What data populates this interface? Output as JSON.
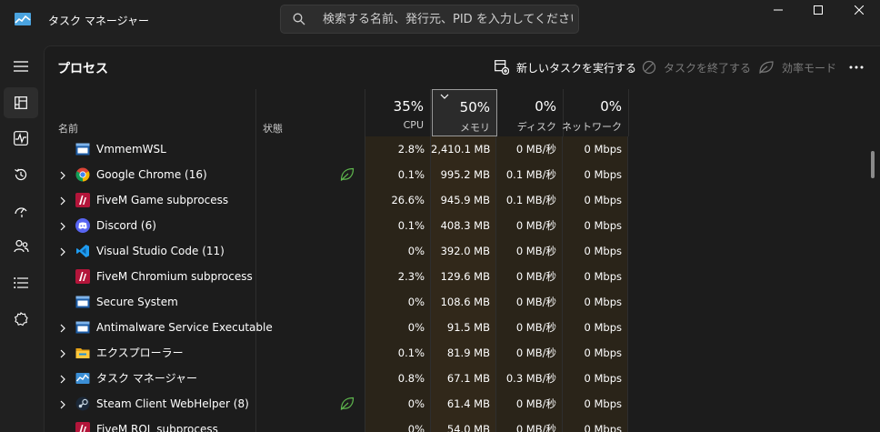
{
  "window": {
    "title": "タスク マネージャー",
    "search_placeholder": "検索する名前、発行元、PID を入力してください"
  },
  "toolbar": {
    "page_title": "プロセス",
    "new_task": "新しいタスクを実行する",
    "end_task": "タスクを終了する",
    "efficiency_mode": "効率モード"
  },
  "nav": {
    "items": [
      "menu-icon",
      "processes-icon",
      "performance-icon",
      "app-history-icon",
      "startup-apps-icon",
      "users-icon",
      "details-icon",
      "services-icon"
    ]
  },
  "columns": {
    "name": "名前",
    "status": "状態",
    "cpu_pct": "35%",
    "cpu_label": "CPU",
    "mem_pct": "50%",
    "mem_label": "メモリ",
    "disk_pct": "0%",
    "disk_label": "ディスク",
    "net_pct": "0%",
    "net_label": "ネットワーク"
  },
  "processes": [
    {
      "name": "VmmemWSL",
      "icon": "system-window-icon",
      "expandable": false,
      "eco": false,
      "cpu": "2.8%",
      "mem": "2,410.1 MB",
      "disk": "0 MB/秒",
      "net": "0 Mbps"
    },
    {
      "name": "Google Chrome (16)",
      "icon": "chrome-icon",
      "expandable": true,
      "eco": true,
      "cpu": "0.1%",
      "mem": "995.2 MB",
      "disk": "0.1 MB/秒",
      "net": "0 Mbps"
    },
    {
      "name": "FiveM Game subprocess",
      "icon": "fivem-icon",
      "expandable": true,
      "eco": false,
      "cpu": "26.6%",
      "mem": "945.9 MB",
      "disk": "0.1 MB/秒",
      "net": "0 Mbps"
    },
    {
      "name": "Discord (6)",
      "icon": "discord-icon",
      "expandable": true,
      "eco": false,
      "cpu": "0.1%",
      "mem": "408.3 MB",
      "disk": "0 MB/秒",
      "net": "0 Mbps"
    },
    {
      "name": "Visual Studio Code (11)",
      "icon": "vscode-icon",
      "expandable": true,
      "eco": false,
      "cpu": "0%",
      "mem": "392.0 MB",
      "disk": "0 MB/秒",
      "net": "0 Mbps"
    },
    {
      "name": "FiveM Chromium subprocess",
      "icon": "fivem-icon",
      "expandable": false,
      "eco": false,
      "cpu": "2.3%",
      "mem": "129.6 MB",
      "disk": "0 MB/秒",
      "net": "0 Mbps"
    },
    {
      "name": "Secure System",
      "icon": "system-window-icon",
      "expandable": false,
      "eco": false,
      "cpu": "0%",
      "mem": "108.6 MB",
      "disk": "0 MB/秒",
      "net": "0 Mbps"
    },
    {
      "name": "Antimalware Service Executable",
      "icon": "system-window-icon",
      "expandable": true,
      "eco": false,
      "cpu": "0%",
      "mem": "91.5 MB",
      "disk": "0 MB/秒",
      "net": "0 Mbps"
    },
    {
      "name": "エクスプローラー",
      "icon": "folder-icon",
      "expandable": true,
      "eco": false,
      "cpu": "0.1%",
      "mem": "81.9 MB",
      "disk": "0 MB/秒",
      "net": "0 Mbps"
    },
    {
      "name": "タスク マネージャー",
      "icon": "task-manager-icon",
      "expandable": true,
      "eco": false,
      "cpu": "0.8%",
      "mem": "67.1 MB",
      "disk": "0.3 MB/秒",
      "net": "0 Mbps"
    },
    {
      "name": "Steam Client WebHelper (8)",
      "icon": "steam-icon",
      "expandable": true,
      "eco": true,
      "cpu": "0%",
      "mem": "61.4 MB",
      "disk": "0 MB/秒",
      "net": "0 Mbps"
    },
    {
      "name": "FiveM ROL subprocess",
      "icon": "fivem-icon",
      "expandable": false,
      "eco": false,
      "cpu": "0%",
      "mem": "54.0 MB",
      "disk": "0 MB/秒",
      "net": "0 Mbps"
    }
  ]
}
